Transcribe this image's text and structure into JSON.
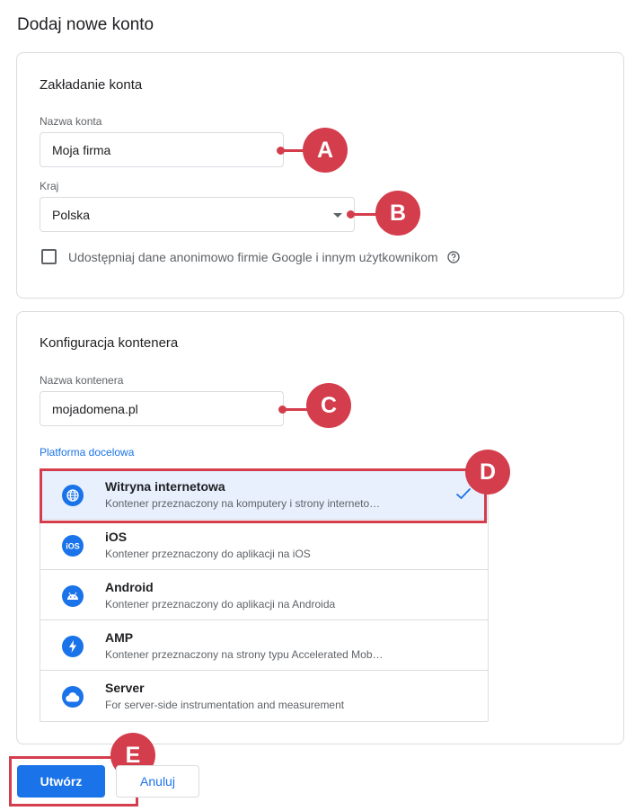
{
  "page": {
    "title": "Dodaj nowe konto"
  },
  "account": {
    "title": "Zakładanie konta",
    "name_label": "Nazwa konta",
    "name_value": "Moja firma",
    "country_label": "Kraj",
    "country_value": "Polska",
    "share_label": "Udostępniaj dane anonimowo firmie Google i innym użytkownikom"
  },
  "container": {
    "title": "Konfiguracja kontenera",
    "name_label": "Nazwa kontenera",
    "name_value": "mojadomena.pl",
    "platform_label": "Platforma docelowa",
    "platforms": [
      {
        "name": "Witryna internetowa",
        "desc": "Kontener przeznaczony na komputery i strony interneto…",
        "icon": "globe-icon",
        "selected": true
      },
      {
        "name": "iOS",
        "desc": "Kontener przeznaczony do aplikacji na iOS",
        "icon": "ios-icon",
        "selected": false
      },
      {
        "name": "Android",
        "desc": "Kontener przeznaczony do aplikacji na Androida",
        "icon": "android-icon",
        "selected": false
      },
      {
        "name": "AMP",
        "desc": "Kontener przeznaczony na strony typu Accelerated Mob…",
        "icon": "bolt-icon",
        "selected": false
      },
      {
        "name": "Server",
        "desc": "For server-side instrumentation and measurement",
        "icon": "cloud-icon",
        "selected": false
      }
    ]
  },
  "buttons": {
    "create": "Utwórz",
    "cancel": "Anuluj"
  },
  "markers": {
    "a": "A",
    "b": "B",
    "c": "C",
    "d": "D",
    "e": "E"
  },
  "colors": {
    "accent": "#1a73e8",
    "marker": "#d43d4c",
    "selected_bg": "#e8f0fe",
    "border": "#dadce0"
  }
}
